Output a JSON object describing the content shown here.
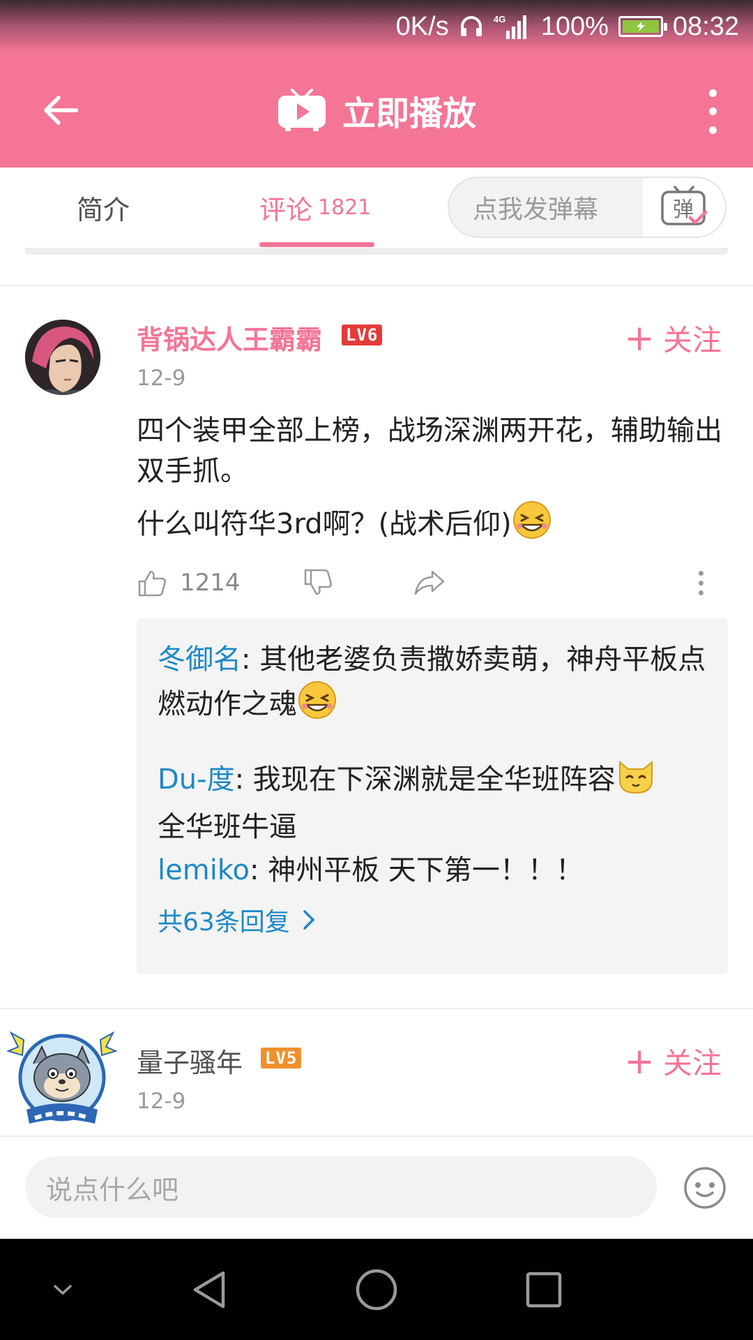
{
  "status_bar": {
    "net_speed": "0K/s",
    "network": "4G",
    "battery": "100%",
    "time": "08:32"
  },
  "toolbar": {
    "title": "立即播放"
  },
  "tabs": {
    "intro": "简介",
    "comments": "评论",
    "comments_count": "1821",
    "danmaku_placeholder": "点我发弹幕",
    "danmaku_button": "弹"
  },
  "comments": [
    {
      "username": "背锅达人王霸霸",
      "level": "LV6",
      "level_color": "#e23b3b",
      "follow_label": "关注",
      "date": "12-9",
      "text_line1": "四个装甲全部上榜，战场深渊两开花，辅助输出双手抓。",
      "text_line2": "什么叫符华3rd啊？(战术后仰)",
      "likes": "1214",
      "replies": [
        {
          "name": "冬御名",
          "text": ": 其他老婆负责撒娇卖萌，神舟平板点燃动作之魂"
        },
        {
          "name": "Du-度",
          "text": ": 我现在下深渊就是全华班阵容",
          "text_after": "全华班牛逼"
        },
        {
          "name": "lemiko",
          "text": ": 神州平板 天下第一！！！"
        }
      ],
      "more_replies": "共63条回复"
    },
    {
      "username": "量子骚年",
      "level": "LV5",
      "level_color": "#f0902c",
      "follow_label": "关注",
      "date": "12-9"
    }
  ],
  "bottom_bar": {
    "input_placeholder": "说点什么吧"
  },
  "colors": {
    "accent": "#f47596",
    "link": "#1e88c8"
  }
}
